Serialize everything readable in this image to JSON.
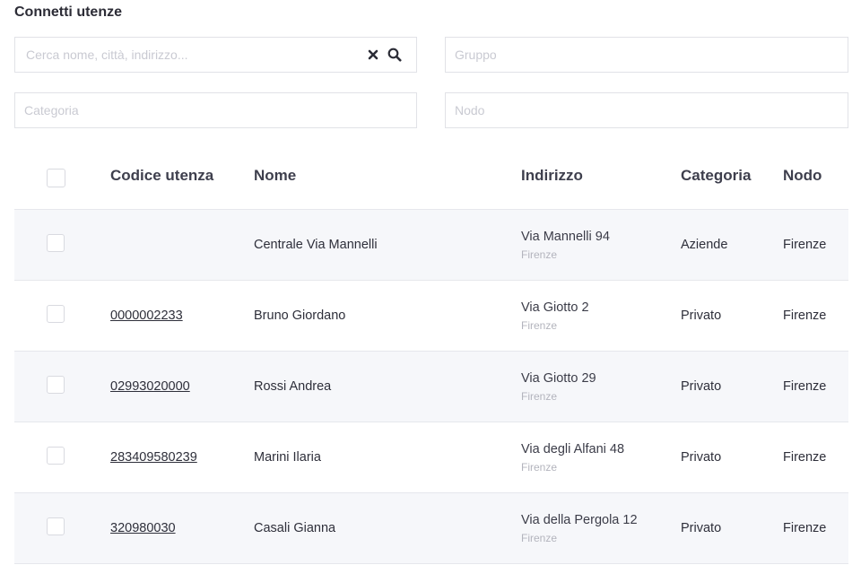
{
  "page": {
    "title": "Connetti utenze"
  },
  "filters": {
    "search_placeholder": "Cerca nome, città, indirizzo...",
    "search_value": "",
    "gruppo_placeholder": "Gruppo",
    "categoria_placeholder": "Categoria",
    "nodo_placeholder": "Nodo"
  },
  "table": {
    "headers": {
      "codice": "Codice utenza",
      "nome": "Nome",
      "indirizzo": "Indirizzo",
      "categoria": "Categoria",
      "nodo": "Nodo"
    },
    "rows": [
      {
        "checked": false,
        "code": "",
        "name": "Centrale Via Mannelli",
        "address": "Via Mannelli 94",
        "city": "Firenze",
        "category": "Aziende",
        "node": "Firenze"
      },
      {
        "checked": false,
        "code": "0000002233",
        "name": "Bruno Giordano",
        "address": "Via Giotto 2",
        "city": "Firenze",
        "category": "Privato",
        "node": "Firenze"
      },
      {
        "checked": false,
        "code": "02993020000",
        "name": "Rossi Andrea",
        "address": "Via Giotto 29",
        "city": "Firenze",
        "category": "Privato",
        "node": "Firenze"
      },
      {
        "checked": false,
        "code": "283409580239",
        "name": "Marini Ilaria",
        "address": "Via degli Alfani 48",
        "city": "Firenze",
        "category": "Privato",
        "node": "Firenze"
      },
      {
        "checked": false,
        "code": "320980030",
        "name": "Casali Gianna",
        "address": "Via della Pergola 12",
        "city": "Firenze",
        "category": "Privato",
        "node": "Firenze"
      }
    ]
  },
  "icons": {
    "clear": "close-icon",
    "search": "search-icon"
  },
  "colors": {
    "row_alt": "#f6f7fa",
    "border": "#e1e2e7",
    "placeholder": "#c9cad2"
  }
}
